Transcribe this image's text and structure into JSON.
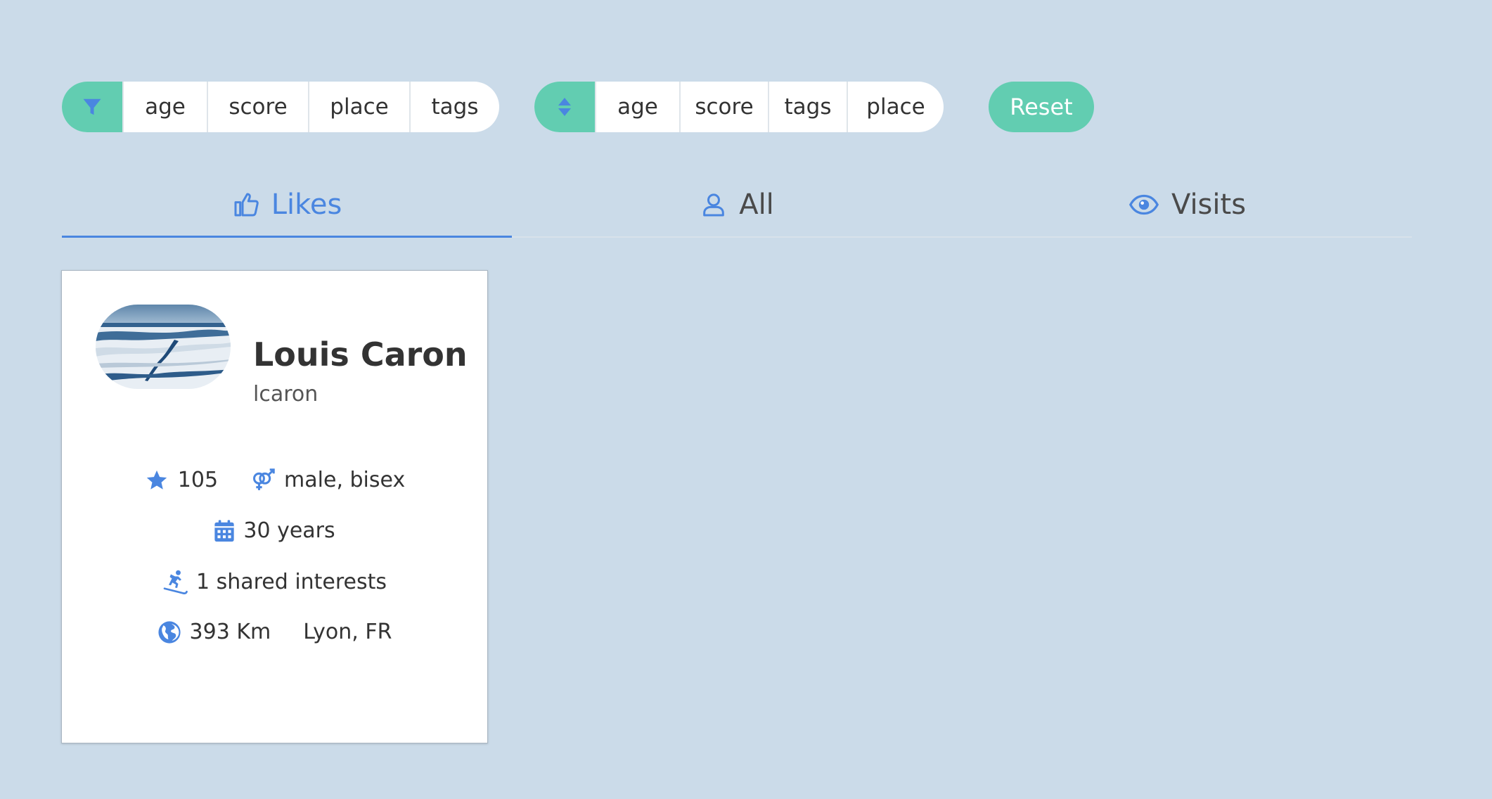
{
  "filter_group": {
    "icon": "filter-icon",
    "items": [
      {
        "label": "age"
      },
      {
        "label": "score"
      },
      {
        "label": "place"
      },
      {
        "label": "tags"
      }
    ]
  },
  "sort_group": {
    "icon": "sort-icon",
    "items": [
      {
        "label": "age"
      },
      {
        "label": "score"
      },
      {
        "label": "tags"
      },
      {
        "label": "place"
      }
    ]
  },
  "reset_label": "Reset",
  "tabs": [
    {
      "label": "Likes",
      "icon": "thumbs-up-icon",
      "active": true
    },
    {
      "label": "All",
      "icon": "user-icon",
      "active": false
    },
    {
      "label": "Visits",
      "icon": "eye-icon",
      "active": false
    }
  ],
  "profile": {
    "name": "Louis Caron",
    "username": "lcaron",
    "score": "105",
    "gender": "male, bisex",
    "age": "30 years",
    "shared": "1 shared interests",
    "distance": "393 Km",
    "location": "Lyon, FR"
  },
  "colors": {
    "background": "#cbdbe9",
    "accent": "#62cdb1",
    "primary_blue": "#4a86e0"
  }
}
